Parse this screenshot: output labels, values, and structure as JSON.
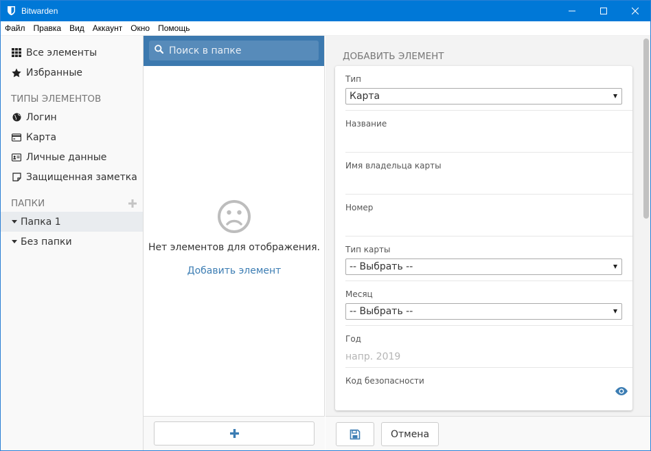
{
  "window": {
    "title": "Bitwarden"
  },
  "menu": [
    "Файл",
    "Правка",
    "Вид",
    "Аккаунт",
    "Окно",
    "Помощь"
  ],
  "sidebar": {
    "all_items": "Все элементы",
    "favorites": "Избранные",
    "types_heading": "ТИПЫ ЭЛЕМЕНТОВ",
    "types": [
      "Логин",
      "Карта",
      "Личные данные",
      "Защищенная заметка"
    ],
    "folders_heading": "ПАПКИ",
    "folders": [
      "Папка 1",
      "Без папки"
    ]
  },
  "list": {
    "search_placeholder": "Поиск в папке",
    "empty_text": "Нет элементов для отображения.",
    "add_link": "Добавить элемент"
  },
  "detail": {
    "heading": "ДОБАВИТЬ ЭЛЕМЕНТ",
    "type_label": "Тип",
    "type_value": "Карта",
    "name_label": "Название",
    "holder_label": "Имя владельца карты",
    "number_label": "Номер",
    "brand_label": "Тип карты",
    "brand_value": "-- Выбрать --",
    "month_label": "Месяц",
    "month_value": "-- Выбрать --",
    "year_label": "Год",
    "year_placeholder": "напр. 2019",
    "code_label": "Код безопасности",
    "cancel_label": "Отмена"
  },
  "colors": {
    "titlebar": "#0078d7",
    "search_bg": "#3c79af",
    "link": "#3c7db3"
  }
}
